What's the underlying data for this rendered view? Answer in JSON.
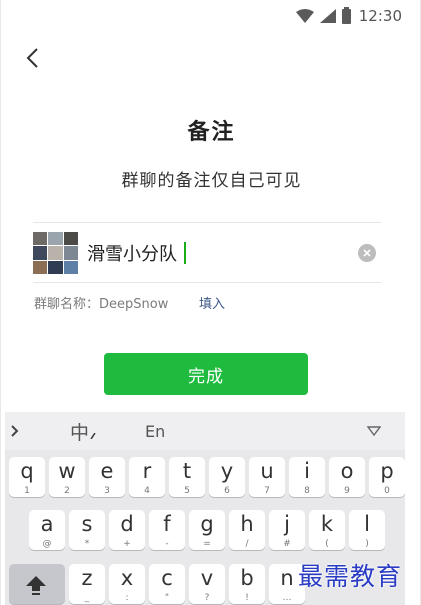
{
  "status_bar": {
    "time": "12:30"
  },
  "page": {
    "title": "备注",
    "subtitle": "群聊的备注仅自己可见"
  },
  "remark_input": {
    "value": "滑雪小分队"
  },
  "group_name": {
    "hint": "群聊名称：DeepSnow",
    "fill_label": "填入"
  },
  "done_button": {
    "label": "完成"
  },
  "keyboard": {
    "lang_zh": "中",
    "lang_en": "En",
    "row1": [
      {
        "main": "q",
        "sub": "1"
      },
      {
        "main": "w",
        "sub": "2"
      },
      {
        "main": "e",
        "sub": "3"
      },
      {
        "main": "r",
        "sub": "4"
      },
      {
        "main": "t",
        "sub": "5"
      },
      {
        "main": "y",
        "sub": "6"
      },
      {
        "main": "u",
        "sub": "7"
      },
      {
        "main": "i",
        "sub": "8"
      },
      {
        "main": "o",
        "sub": "9"
      },
      {
        "main": "p",
        "sub": "0"
      }
    ],
    "row2": [
      {
        "main": "a",
        "sub": "@"
      },
      {
        "main": "s",
        "sub": "*"
      },
      {
        "main": "d",
        "sub": "+"
      },
      {
        "main": "f",
        "sub": "-"
      },
      {
        "main": "g",
        "sub": "="
      },
      {
        "main": "h",
        "sub": "/"
      },
      {
        "main": "j",
        "sub": "#"
      },
      {
        "main": "k",
        "sub": "("
      },
      {
        "main": "l",
        "sub": ")"
      }
    ],
    "row3": [
      {
        "main": "z",
        "sub": "_"
      },
      {
        "main": "x",
        "sub": ":"
      },
      {
        "main": "c",
        "sub": "\""
      },
      {
        "main": "v",
        "sub": "?"
      },
      {
        "main": "b",
        "sub": "!"
      },
      {
        "main": "n",
        "sub": "…"
      }
    ]
  },
  "watermark": "最需教育",
  "colors": {
    "accent_green": "#1fbb3f",
    "cursor_green": "#1aad19",
    "link_blue": "#3d5a8a",
    "watermark_blue": "#2a3cc4"
  },
  "icons": [
    "wifi-icon",
    "signal-icon",
    "battery-icon",
    "back-arrow-icon",
    "group-avatar",
    "clear-icon",
    "chevron-right-icon",
    "keyboard-hide-icon",
    "shift-icon"
  ]
}
